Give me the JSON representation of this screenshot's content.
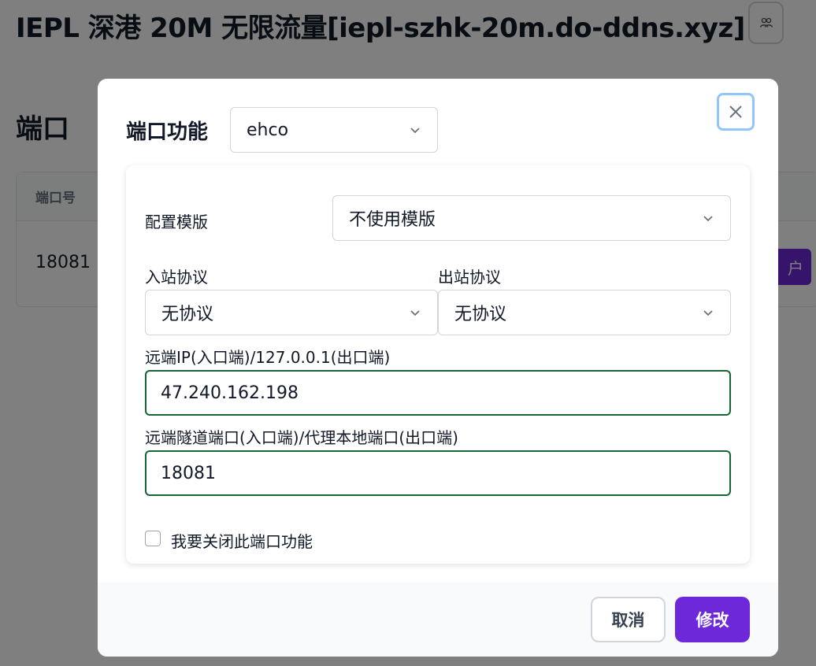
{
  "background": {
    "page_title": "IEPL 深港 20M 无限流量[iepl-szhk-20m.do-ddns.xyz]",
    "title_button_icon": "users-icon",
    "section_title": "端口",
    "table": {
      "columns": [
        "端口号"
      ],
      "rows": [
        [
          "18081"
        ]
      ]
    },
    "action_button_visible_label": "户"
  },
  "modal": {
    "header_label": "端口功能",
    "function_select_value": "ehco",
    "close_icon": "close-icon",
    "template": {
      "label": "配置模版",
      "value": "不使用模版"
    },
    "inbound": {
      "label": "入站协议",
      "value": "无协议"
    },
    "outbound": {
      "label": "出站协议",
      "value": "无协议"
    },
    "remote_ip": {
      "label": "远端IP(入口端)/127.0.0.1(出口端)",
      "value": "47.240.162.198"
    },
    "remote_port": {
      "label": "远端隧道端口(入口端)/代理本地端口(出口端)",
      "value": "18081"
    },
    "disable_checkbox": {
      "label": "我要关闭此端口功能",
      "checked": false
    },
    "footer": {
      "cancel_label": "取消",
      "submit_label": "修改"
    }
  },
  "colors": {
    "accent": "#6d28d9",
    "input_border": "#166534",
    "focus_ring": "#93c5fd"
  }
}
